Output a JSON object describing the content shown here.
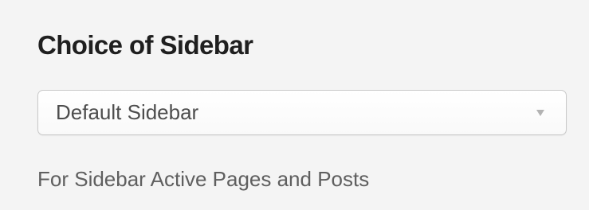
{
  "sidebar_setting": {
    "title": "Choice of Sidebar",
    "select": {
      "selected_value": "Default Sidebar"
    },
    "description": "For Sidebar Active Pages and Posts"
  }
}
